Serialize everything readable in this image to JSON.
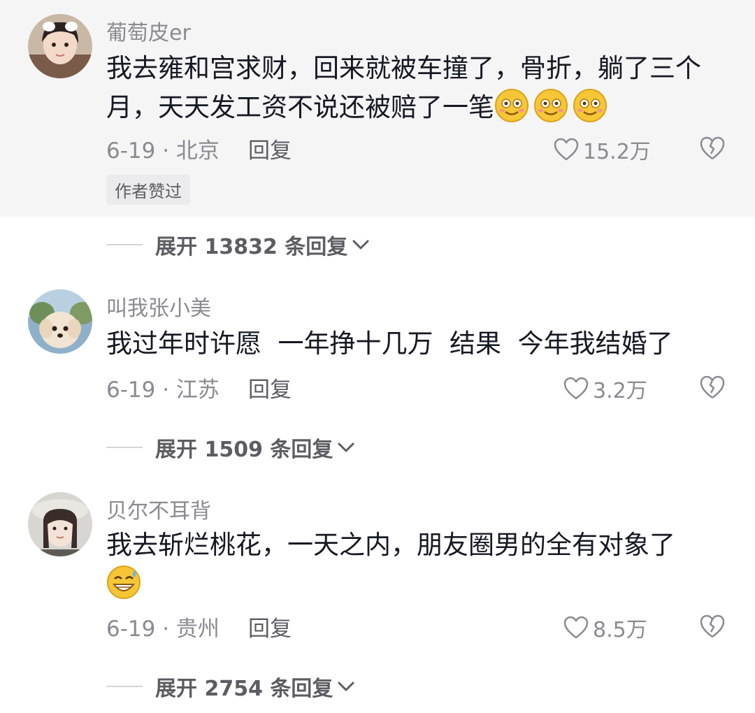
{
  "comments": [
    {
      "username": "葡萄皮er",
      "text": "我去雍和宫求财，回来就被车撞了，骨折，躺了三个月，天天发工资不说还被赔了一笔",
      "emojis": [
        "smile-emoji",
        "smile-emoji",
        "smile-emoji"
      ],
      "date": "6-19",
      "location": "北京",
      "reply_label": "回复",
      "likes": "15.2万",
      "badge": "作者赞过",
      "expand_label": "展开 13832 条回复",
      "highlighted": true
    },
    {
      "username": "叫我张小美",
      "text": "我过年时许愿  一年挣十几万  结果  今年我结婚了",
      "date": "6-19",
      "location": "江苏",
      "reply_label": "回复",
      "likes": "3.2万",
      "expand_label": "展开 1509 条回复"
    },
    {
      "username": "贝尔不耳背",
      "text": "我去斩烂桃花，一天之内，朋友圈男的全有对象了",
      "emojis": [
        "sweat-grin-emoji"
      ],
      "date": "6-19",
      "location": "贵州",
      "reply_label": "回复",
      "likes": "8.5万",
      "expand_label": "展开 2754 条回复"
    }
  ],
  "colors": {
    "highlight_bg": "#f5f5f6",
    "secondary_text": "#8a8b91",
    "primary_text": "#161823"
  }
}
